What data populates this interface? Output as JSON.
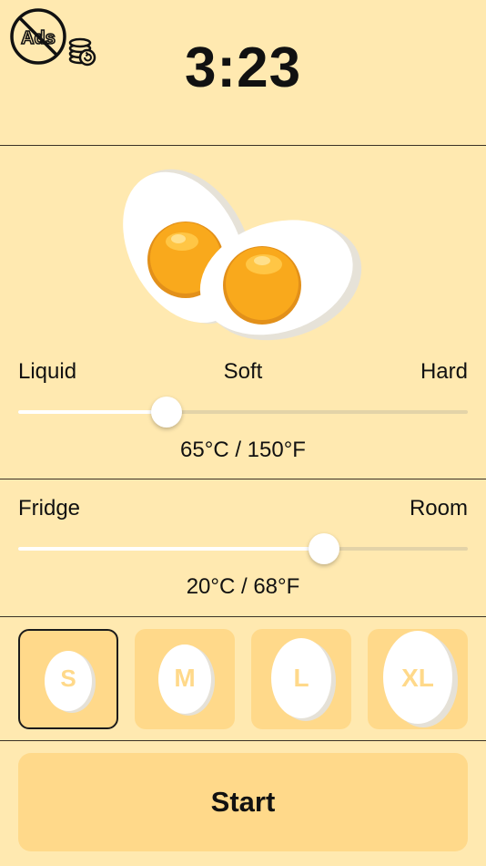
{
  "header": {
    "ads_badge_text": "Ads",
    "timer": "3:23",
    "remove_ads_icon": "no-ads-coins-icon"
  },
  "doneness": {
    "labels": [
      "Liquid",
      "Soft",
      "Hard"
    ],
    "value_fraction": 0.33,
    "temperature": "65°C / 150°F"
  },
  "start_temp": {
    "labels": [
      "Fridge",
      "Room"
    ],
    "value_fraction": 0.68,
    "temperature": "20°C / 68°F"
  },
  "sizes": {
    "items": [
      "S",
      "M",
      "L",
      "XL"
    ],
    "selected": "S"
  },
  "start_button": {
    "label": "Start"
  },
  "colors": {
    "background": "#FFE9B0",
    "button": "#FFD98A",
    "yolk": "#F9A91C",
    "egg_white": "#FFFFFF"
  }
}
